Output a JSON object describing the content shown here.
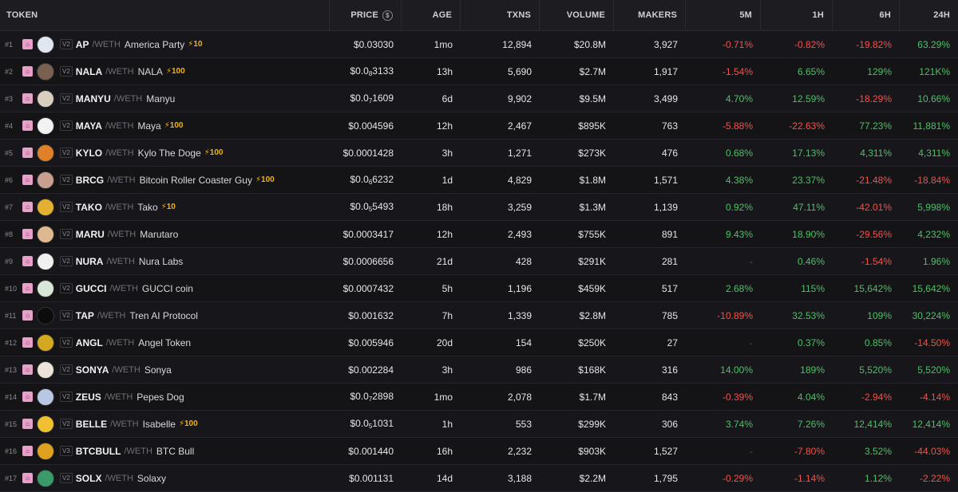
{
  "headers": {
    "token": "TOKEN",
    "price": "PRICE",
    "age": "AGE",
    "txns": "TXNS",
    "volume": "VOLUME",
    "makers": "MAKERS",
    "m5": "5M",
    "h1": "1H",
    "h6": "6H",
    "h24": "24H"
  },
  "quote_symbol": "WETH",
  "rows": [
    {
      "rank": "#1",
      "ver": "V2",
      "symbol": "AP",
      "name": "America Party",
      "boost": "10",
      "price": "$0.03030",
      "age": "1mo",
      "txns": "12,894",
      "volume": "$20.8M",
      "makers": "3,927",
      "m5": "-0.71%",
      "h1": "-0.82%",
      "h6": "-19.82%",
      "h24": "63.29%",
      "logo": "#dfe6f0"
    },
    {
      "rank": "#2",
      "ver": "V2",
      "symbol": "NALA",
      "name": "NALA",
      "boost": "100",
      "price_base": "$0.0",
      "price_sub": "8",
      "price_tail": "3133",
      "age": "13h",
      "txns": "5,690",
      "volume": "$2.7M",
      "makers": "1,917",
      "m5": "-1.54%",
      "h1": "6.65%",
      "h6": "129%",
      "h24": "121K%",
      "logo": "#7a6050"
    },
    {
      "rank": "#3",
      "ver": "V2",
      "symbol": "MANYU",
      "name": "Manyu",
      "boost": "",
      "price_base": "$0.0",
      "price_sub": "7",
      "price_tail": "1609",
      "age": "6d",
      "txns": "9,902",
      "volume": "$9.5M",
      "makers": "3,499",
      "m5": "4.70%",
      "h1": "12.59%",
      "h6": "-18.29%",
      "h24": "10.66%",
      "logo": "#d9cfc0"
    },
    {
      "rank": "#4",
      "ver": "V2",
      "symbol": "MAYA",
      "name": "Maya",
      "boost": "100",
      "price": "$0.004596",
      "age": "12h",
      "txns": "2,467",
      "volume": "$895K",
      "makers": "763",
      "m5": "-5.88%",
      "h1": "-22.63%",
      "h6": "77.23%",
      "h24": "11,881%",
      "logo": "#f2f2f2"
    },
    {
      "rank": "#5",
      "ver": "V2",
      "symbol": "KYLO",
      "name": "Kylo The Doge",
      "boost": "100",
      "price": "$0.0001428",
      "age": "3h",
      "txns": "1,271",
      "volume": "$273K",
      "makers": "476",
      "m5": "0.68%",
      "h1": "17.13%",
      "h6": "4,311%",
      "h24": "4,311%",
      "logo": "#e0802a"
    },
    {
      "rank": "#6",
      "ver": "V2",
      "symbol": "BRCG",
      "name": "Bitcoin Roller Coaster Guy",
      "boost": "100",
      "price_base": "$0.0",
      "price_sub": "6",
      "price_tail": "6232",
      "age": "1d",
      "txns": "4,829",
      "volume": "$1.8M",
      "makers": "1,571",
      "m5": "4.38%",
      "h1": "23.37%",
      "h6": "-21.48%",
      "h24": "-18.84%",
      "logo": "#c9a090"
    },
    {
      "rank": "#7",
      "ver": "V2",
      "symbol": "TAKO",
      "name": "Tako",
      "boost": "10",
      "price_base": "$0.0",
      "price_sub": "5",
      "price_tail": "5493",
      "age": "18h",
      "txns": "3,259",
      "volume": "$1.3M",
      "makers": "1,139",
      "m5": "0.92%",
      "h1": "47.11%",
      "h6": "-42.01%",
      "h24": "5,998%",
      "logo": "#e5b030"
    },
    {
      "rank": "#8",
      "ver": "V2",
      "symbol": "MARU",
      "name": "Marutaro",
      "boost": "",
      "price": "$0.0003417",
      "age": "12h",
      "txns": "2,493",
      "volume": "$755K",
      "makers": "891",
      "m5": "9.43%",
      "h1": "18.90%",
      "h6": "-29.56%",
      "h24": "4,232%",
      "logo": "#e0b890"
    },
    {
      "rank": "#9",
      "ver": "V2",
      "symbol": "NURA",
      "name": "Nura Labs",
      "boost": "",
      "price": "$0.0006656",
      "age": "21d",
      "txns": "428",
      "volume": "$291K",
      "makers": "281",
      "m5": "-",
      "h1": "0.46%",
      "h6": "-1.54%",
      "h24": "1.96%",
      "logo": "#f0f0f0"
    },
    {
      "rank": "#10",
      "ver": "V2",
      "symbol": "GUCCI",
      "name": "GUCCI coin",
      "boost": "",
      "price": "$0.0007432",
      "age": "5h",
      "txns": "1,196",
      "volume": "$459K",
      "makers": "517",
      "m5": "2.68%",
      "h1": "115%",
      "h6": "15,642%",
      "h24": "15,642%",
      "logo": "#d8e8d8"
    },
    {
      "rank": "#11",
      "ver": "V2",
      "symbol": "TAP",
      "name": "Tren AI Protocol",
      "boost": "",
      "price": "$0.001632",
      "age": "7h",
      "txns": "1,339",
      "volume": "$2.8M",
      "makers": "785",
      "m5": "-10.89%",
      "h1": "32.53%",
      "h6": "109%",
      "h24": "30,224%",
      "logo": "#0c0c0c"
    },
    {
      "rank": "#12",
      "ver": "V2",
      "symbol": "ANGL",
      "name": "Angel Token",
      "boost": "",
      "price": "$0.005946",
      "age": "20d",
      "txns": "154",
      "volume": "$250K",
      "makers": "27",
      "m5": "-",
      "h1": "0.37%",
      "h6": "0.85%",
      "h24": "-14.50%",
      "logo": "#d4a820"
    },
    {
      "rank": "#13",
      "ver": "V2",
      "symbol": "SONYA",
      "name": "Sonya",
      "boost": "",
      "price": "$0.002284",
      "age": "3h",
      "txns": "986",
      "volume": "$168K",
      "makers": "316",
      "m5": "14.00%",
      "h1": "189%",
      "h6": "5,520%",
      "h24": "5,520%",
      "logo": "#ece4d8"
    },
    {
      "rank": "#14",
      "ver": "V2",
      "symbol": "ZEUS",
      "name": "Pepes Dog",
      "boost": "",
      "price_base": "$0.0",
      "price_sub": "7",
      "price_tail": "2898",
      "age": "1mo",
      "txns": "2,078",
      "volume": "$1.7M",
      "makers": "843",
      "m5": "-0.39%",
      "h1": "4.04%",
      "h6": "-2.94%",
      "h24": "-4.14%",
      "logo": "#b8c8e0"
    },
    {
      "rank": "#15",
      "ver": "V2",
      "symbol": "BELLE",
      "name": "Isabelle",
      "boost": "100",
      "price_base": "$0.0",
      "price_sub": "5",
      "price_tail": "1031",
      "age": "1h",
      "txns": "553",
      "volume": "$299K",
      "makers": "306",
      "m5": "3.74%",
      "h1": "7.26%",
      "h6": "12,414%",
      "h24": "12,414%",
      "logo": "#f0c030"
    },
    {
      "rank": "#16",
      "ver": "V3",
      "symbol": "BTCBULL",
      "name": "BTC Bull",
      "boost": "",
      "price": "$0.001440",
      "age": "16h",
      "txns": "2,232",
      "volume": "$903K",
      "makers": "1,527",
      "m5": "-",
      "h1": "-7.80%",
      "h6": "3.52%",
      "h24": "-44.03%",
      "logo": "#e0a020"
    },
    {
      "rank": "#17",
      "ver": "V2",
      "symbol": "SOLX",
      "name": "Solaxy",
      "boost": "",
      "price": "$0.001131",
      "age": "14d",
      "txns": "3,188",
      "volume": "$2.2M",
      "makers": "1,795",
      "m5": "-0.29%",
      "h1": "-1.14%",
      "h6": "1.12%",
      "h24": "-2.22%",
      "logo": "#3a9a6a"
    }
  ]
}
